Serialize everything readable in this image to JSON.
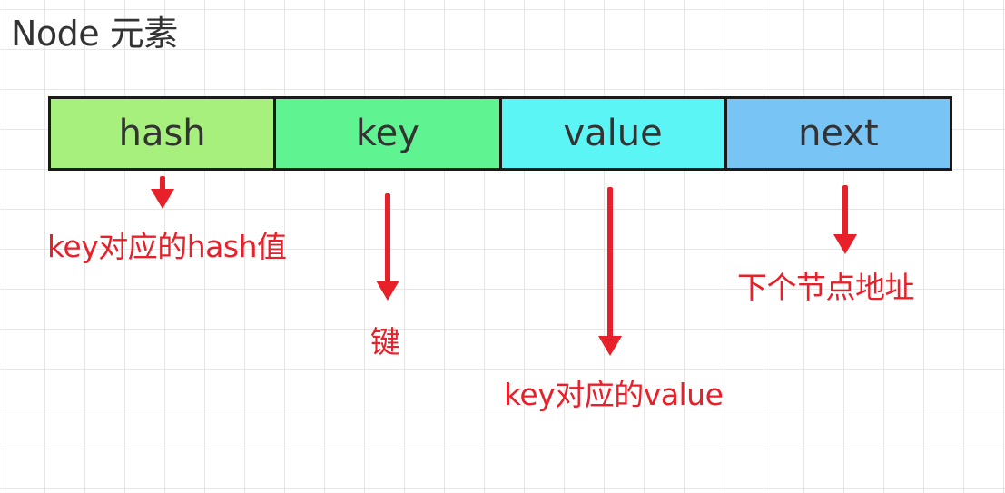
{
  "title": "Node 元素",
  "fields": [
    {
      "label": "hash",
      "color": "#a8f07e",
      "description": "key对应的hash值"
    },
    {
      "label": "key",
      "color": "#60f391",
      "description": "键"
    },
    {
      "label": "value",
      "color": "#5cf5f5",
      "description": "key对应的value"
    },
    {
      "label": "next",
      "color": "#78c4f5",
      "description": "下个节点地址"
    }
  ],
  "arrow_color": "#e8202a"
}
